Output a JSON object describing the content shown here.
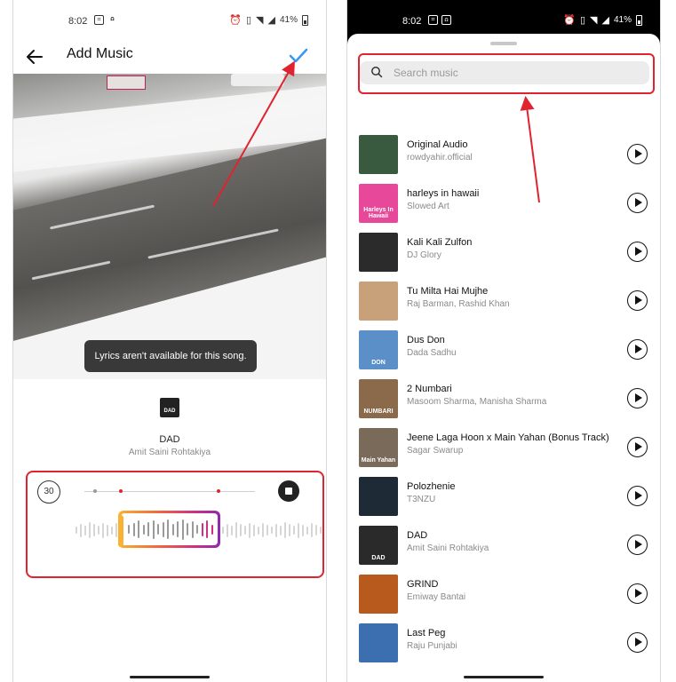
{
  "left": {
    "status": {
      "time": "8:02",
      "battery": "41%"
    },
    "header": {
      "title": "Add Music",
      "back_icon": "arrow-left-icon",
      "confirm_icon": "checkmark-icon"
    },
    "toast": "Lyrics aren't available for this song.",
    "song": {
      "cover_label": "DAD",
      "title": "DAD",
      "artist": "Amit Saini Rohtakiya"
    },
    "trimmer": {
      "duration": "30",
      "stop_icon": "stop-icon"
    },
    "accent": "#3897f0",
    "highlight_color": "#e0232f"
  },
  "right": {
    "status": {
      "time": "8:02",
      "battery": "41%"
    },
    "search": {
      "placeholder": "Search music",
      "icon": "search-icon"
    },
    "tracks": [
      {
        "title": "Original Audio",
        "artist": "rowdyahir.official",
        "cover_color": "#3a5a40"
      },
      {
        "title": "harleys in hawaii",
        "artist": "Slowed Art",
        "cover_color": "#e8489a",
        "cover_text": "Harleys In Hawaii"
      },
      {
        "title": "Kali Kali Zulfon",
        "artist": "DJ Glory",
        "cover_color": "#2b2b2b"
      },
      {
        "title": "Tu Milta Hai Mujhe",
        "artist": "Raj Barman, Rashid Khan",
        "cover_color": "#c8a07a"
      },
      {
        "title": "Dus Don",
        "artist": "Dada Sadhu",
        "cover_color": "#5a8fc8",
        "cover_text": "DON"
      },
      {
        "title": "2 Numbari",
        "artist": "Masoom Sharma, Manisha Sharma",
        "cover_color": "#8a6a4a",
        "cover_text": "NUMBARI"
      },
      {
        "title": "Jeene Laga Hoon x Main Yahan (Bonus Track)",
        "artist": "Sagar Swarup",
        "cover_color": "#7a6a5a",
        "cover_text": "Main Yahan"
      },
      {
        "title": "Polozhenie",
        "artist": "T3NZU",
        "cover_color": "#1e2a36"
      },
      {
        "title": "DAD",
        "artist": "Amit Saini Rohtakiya",
        "cover_color": "#2a2a2a",
        "cover_text": "DAD"
      },
      {
        "title": "GRIND",
        "artist": "Emiway Bantai",
        "cover_color": "#b85a1e"
      },
      {
        "title": "Last Peg",
        "artist": "Raju Punjabi",
        "cover_color": "#3b6fb0"
      }
    ],
    "play_icon": "play-icon"
  }
}
